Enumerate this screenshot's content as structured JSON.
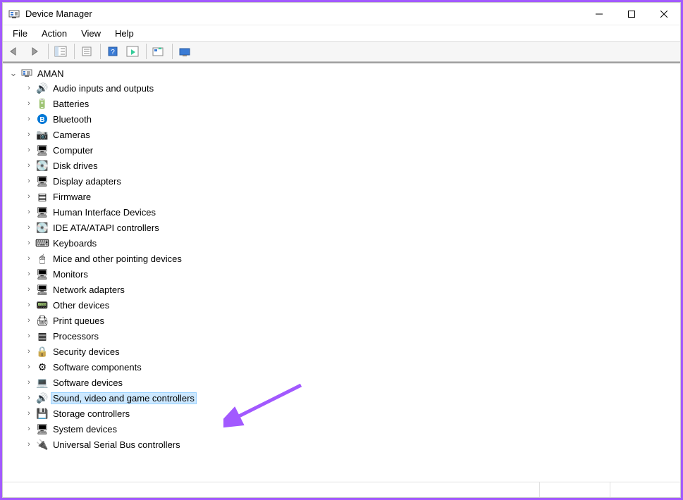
{
  "window": {
    "title": "Device Manager"
  },
  "menu": {
    "file": "File",
    "action": "Action",
    "view": "View",
    "help": "Help"
  },
  "tree": {
    "root": "AMAN",
    "nodes": [
      {
        "id": "audio-inputs-outputs",
        "label": "Audio inputs and outputs",
        "icon": "🔊"
      },
      {
        "id": "batteries",
        "label": "Batteries",
        "icon": "🔋"
      },
      {
        "id": "bluetooth",
        "label": "Bluetooth",
        "icon": "B"
      },
      {
        "id": "cameras",
        "label": "Cameras",
        "icon": "📷"
      },
      {
        "id": "computer",
        "label": "Computer",
        "icon": "🖥"
      },
      {
        "id": "disk-drives",
        "label": "Disk drives",
        "icon": "💽"
      },
      {
        "id": "display-adapters",
        "label": "Display adapters",
        "icon": "🖥"
      },
      {
        "id": "firmware",
        "label": "Firmware",
        "icon": "▤"
      },
      {
        "id": "hid",
        "label": "Human Interface Devices",
        "icon": "🖥"
      },
      {
        "id": "ide-atapi",
        "label": "IDE ATA/ATAPI controllers",
        "icon": "💽"
      },
      {
        "id": "keyboards",
        "label": "Keyboards",
        "icon": "⌨"
      },
      {
        "id": "mice",
        "label": "Mice and other pointing devices",
        "icon": "🖱"
      },
      {
        "id": "monitors",
        "label": "Monitors",
        "icon": "🖥"
      },
      {
        "id": "network-adapters",
        "label": "Network adapters",
        "icon": "🖥"
      },
      {
        "id": "other-devices",
        "label": "Other devices",
        "icon": "📟"
      },
      {
        "id": "print-queues",
        "label": "Print queues",
        "icon": "🖨"
      },
      {
        "id": "processors",
        "label": "Processors",
        "icon": "▦"
      },
      {
        "id": "security-devices",
        "label": "Security devices",
        "icon": "🔒"
      },
      {
        "id": "software-components",
        "label": "Software components",
        "icon": "⚙"
      },
      {
        "id": "software-devices",
        "label": "Software devices",
        "icon": "💻"
      },
      {
        "id": "sound-video-game",
        "label": "Sound, video and game controllers",
        "icon": "🔊",
        "selected": true
      },
      {
        "id": "storage-controllers",
        "label": "Storage controllers",
        "icon": "💾"
      },
      {
        "id": "system-devices",
        "label": "System devices",
        "icon": "🖥"
      },
      {
        "id": "usb-controllers",
        "label": "Universal Serial Bus controllers",
        "icon": "🔌"
      }
    ]
  }
}
